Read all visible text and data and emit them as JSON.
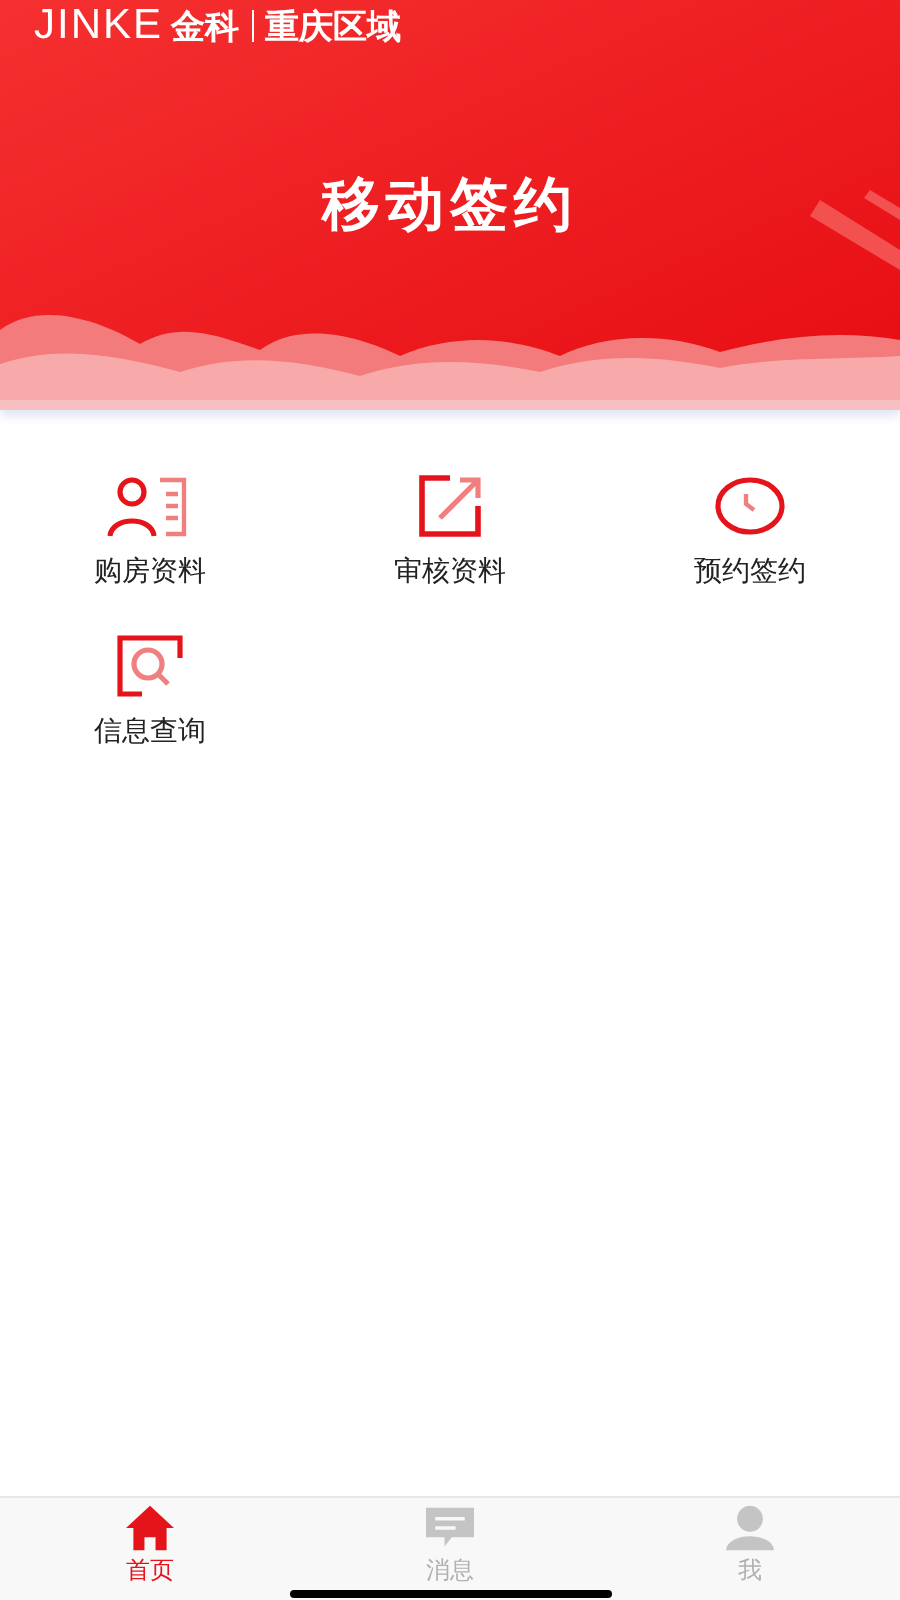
{
  "header": {
    "brand": "JINKE",
    "brand_cn": "金科",
    "region": "重庆区域"
  },
  "banner": {
    "title": "移动签约"
  },
  "menu": [
    {
      "label": "购房资料",
      "kind": "person-doc"
    },
    {
      "label": "审核资料",
      "kind": "edit"
    },
    {
      "label": "预约签约",
      "kind": "clock"
    },
    {
      "label": "信息查询",
      "kind": "search"
    }
  ],
  "tabs": [
    {
      "label": "首页",
      "kind": "home",
      "selected": true
    },
    {
      "label": "消息",
      "kind": "message",
      "selected": false
    },
    {
      "label": "我",
      "kind": "user",
      "selected": false
    }
  ]
}
